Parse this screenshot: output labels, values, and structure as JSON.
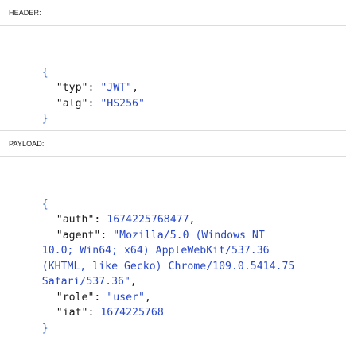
{
  "header": {
    "section_label": "HEADER:",
    "open_brace": "{",
    "close_brace": "}",
    "fields": [
      {
        "key": "\"typ\"",
        "value": "\"JWT\"",
        "trail": ","
      },
      {
        "key": "\"alg\"",
        "value": "\"HS256\"",
        "trail": ""
      }
    ]
  },
  "payload": {
    "section_label": "PAYLOAD:",
    "open_brace": "{",
    "close_brace": "}",
    "auth_key": "\"auth\"",
    "auth_value": "1674225768477",
    "agent_key": "\"agent\"",
    "agent_value_line1": "\"Mozilla/5.0 (Windows NT",
    "agent_value_line2": "10.0; Win64; x64) AppleWebKit/537.36",
    "agent_value_line3": "(KHTML, like Gecko) Chrome/109.0.5414.75",
    "agent_value_line4": "Safari/537.36\"",
    "role_key": "\"role\"",
    "role_value": "\"user\"",
    "iat_key": "\"iat\"",
    "iat_value": "1674225768"
  }
}
